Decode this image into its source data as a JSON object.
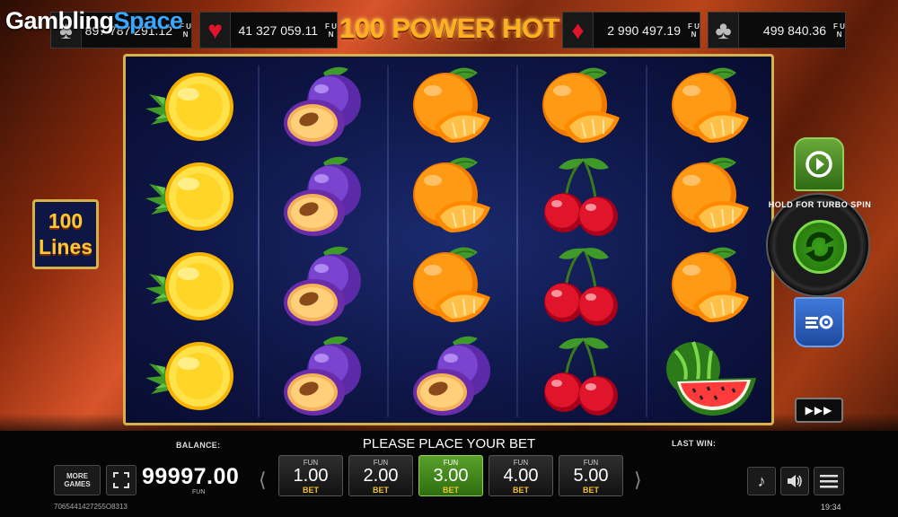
{
  "brand": {
    "part1": "Gambling",
    "part2": "Space"
  },
  "game_title": "100 POWER HOT",
  "jackpots": [
    {
      "suit": "spade-icon",
      "glyph": "♠",
      "amount": "897 787 291.12",
      "fun": "F U N",
      "color": "#bbbbbb"
    },
    {
      "suit": "heart-icon",
      "glyph": "♥",
      "amount": "41 327 059.11",
      "fun": "F U N",
      "color": "#e0142a"
    },
    {
      "suit": "diamond-icon",
      "glyph": "♦",
      "amount": "2 990 497.19",
      "fun": "F U N",
      "color": "#e0142a"
    },
    {
      "suit": "club-icon",
      "glyph": "♣",
      "amount": "499 840.36",
      "fun": "F U N",
      "color": "#bbbbbb"
    }
  ],
  "lines_badge": {
    "number": "100",
    "word": "Lines"
  },
  "reels": [
    [
      "lemon",
      "lemon",
      "lemon",
      "lemon"
    ],
    [
      "plum",
      "plum",
      "plum",
      "plum"
    ],
    [
      "orange",
      "orange",
      "orange",
      "plum"
    ],
    [
      "orange",
      "cherry",
      "cherry",
      "cherry"
    ],
    [
      "orange",
      "orange",
      "orange",
      "watermelon"
    ]
  ],
  "controls": {
    "turbo_hint": "HOLD FOR TURBO SPIN",
    "fast_glyph": "▶▶▶"
  },
  "bottom": {
    "balance_label": "BALANCE:",
    "balance_value": "99997.00",
    "balance_unit": "FUN",
    "message": "PLEASE PLACE YOUR BET",
    "last_win_label": "LAST WIN:",
    "more_games": "MORE GAMES",
    "session_id": "7065441427255O8313",
    "clock": "19:34",
    "arrow_left": "⟨",
    "arrow_right": "⟩"
  },
  "bets": [
    {
      "fun": "FUN",
      "value": "1.00",
      "label": "BET",
      "selected": false
    },
    {
      "fun": "FUN",
      "value": "2.00",
      "label": "BET",
      "selected": false
    },
    {
      "fun": "FUN",
      "value": "3.00",
      "label": "BET",
      "selected": true
    },
    {
      "fun": "FUN",
      "value": "4.00",
      "label": "BET",
      "selected": false
    },
    {
      "fun": "FUN",
      "value": "5.00",
      "label": "BET",
      "selected": false
    }
  ],
  "colors": {
    "gold": "#d7b14a",
    "reel_bg": "#0e1646",
    "accent_green": "#3aa01a",
    "accent_blue": "#3f78d8"
  }
}
